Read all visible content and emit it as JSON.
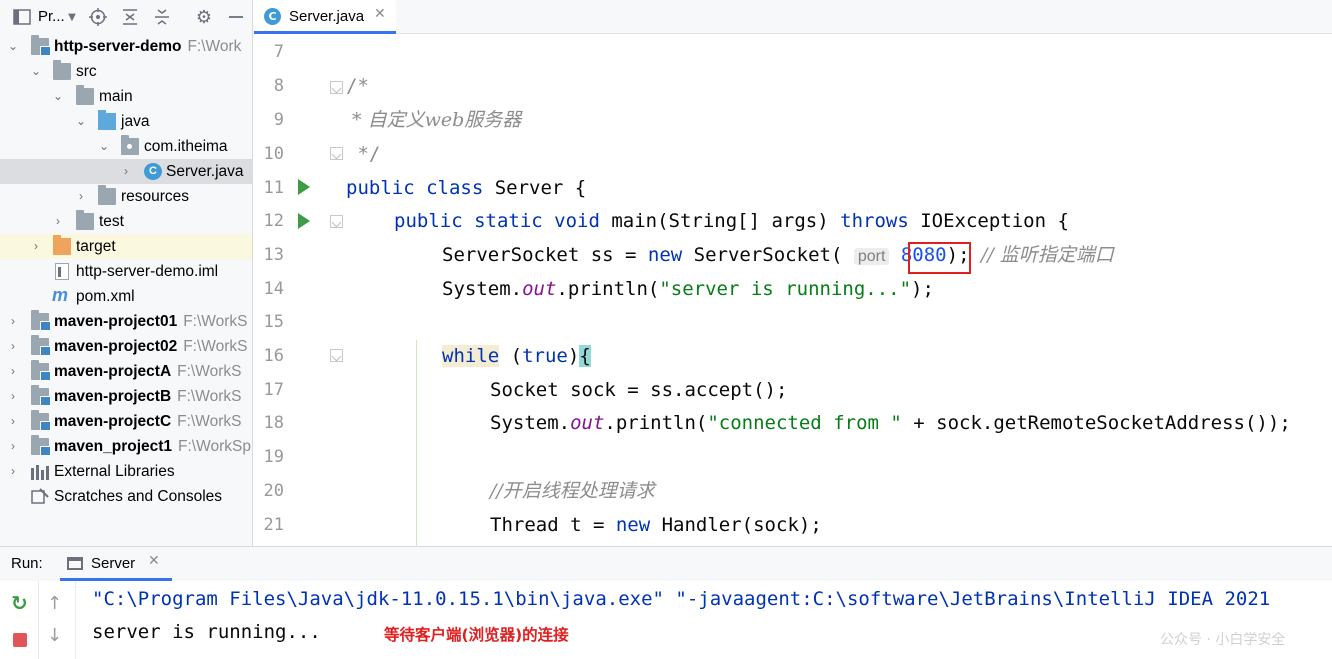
{
  "project_panel": {
    "title": "Pr...",
    "tree": [
      {
        "label": "http-server-demo",
        "path": "F:\\Work",
        "bold": true
      },
      {
        "label": "src"
      },
      {
        "label": "main"
      },
      {
        "label": "java"
      },
      {
        "label": "com.itheima"
      },
      {
        "label": "Server.java"
      },
      {
        "label": "resources"
      },
      {
        "label": "test"
      },
      {
        "label": "target"
      },
      {
        "label": "http-server-demo.iml"
      },
      {
        "label": "pom.xml"
      },
      {
        "label": "maven-project01",
        "path": "F:\\WorkS",
        "bold": true
      },
      {
        "label": "maven-project02",
        "path": "F:\\WorkS",
        "bold": true
      },
      {
        "label": "maven-projectA",
        "path": "F:\\WorkS",
        "bold": true
      },
      {
        "label": "maven-projectB",
        "path": "F:\\WorkS",
        "bold": true
      },
      {
        "label": "maven-projectC",
        "path": "F:\\WorkS",
        "bold": true
      },
      {
        "label": "maven_project1",
        "path": "F:\\WorkSp",
        "bold": true
      },
      {
        "label": "External Libraries"
      },
      {
        "label": "Scratches and Consoles"
      }
    ]
  },
  "editor": {
    "tab": {
      "label": "Server.java",
      "close": "✕"
    },
    "line_numbers": [
      "7",
      "8",
      "9",
      "10",
      "11",
      "12",
      "13",
      "14",
      "15",
      "16",
      "17",
      "18",
      "19",
      "20",
      "21"
    ],
    "code": {
      "l8": "/*",
      "l9": " * 自定义web服务器",
      "l10": " */",
      "l11_kw": "public class",
      "l11_rest": " Server {",
      "l12_kw": "public static void",
      "l12_mid": " main(String[] args) ",
      "l12_kw2": "throws",
      "l12_rest": " IOException {",
      "l13_a": "ServerSocket ss = ",
      "l13_kw": "new",
      "l13_b": " ServerSocket( ",
      "l13_hint": "port",
      "l13_num": "8080",
      "l13_c": "); ",
      "l13_cmt": "// 监听指定端口",
      "l14_a": "System.",
      "l14_field": "out",
      "l14_b": ".println(",
      "l14_str": "\"server is running...\"",
      "l14_c": ");",
      "l16_kw": "while",
      "l16_a": " (",
      "l16_kw2": "true",
      "l16_b": ")",
      "l16_brace": "{",
      "l17": "Socket sock = ss.accept();",
      "l18_a": "System.",
      "l18_field": "out",
      "l18_b": ".println(",
      "l18_str": "\"connected from \"",
      "l18_c": " + sock.getRemoteSocketAddress());",
      "l20": "//开启线程处理请求",
      "l21_a": "Thread t = ",
      "l21_kw": "new",
      "l21_b": " Handler(sock);"
    }
  },
  "run_panel": {
    "label": "Run:",
    "tab_label": "Server",
    "tab_close": "✕",
    "command": "\"C:\\Program Files\\Java\\jdk-11.0.15.1\\bin\\java.exe\" \"-javaagent:C:\\software\\JetBrains\\IntelliJ IDEA 2021",
    "output": "server is running...",
    "annotation": "等待客户端(浏览器)的连接",
    "watermark": "公众号 · 小白学安全"
  },
  "colors": {
    "keyword": "#0033b3",
    "string": "#067d17",
    "comment": "#8c8c8c",
    "number": "#1750eb",
    "annotation_red": "#e02020",
    "accent": "#3574f0"
  }
}
